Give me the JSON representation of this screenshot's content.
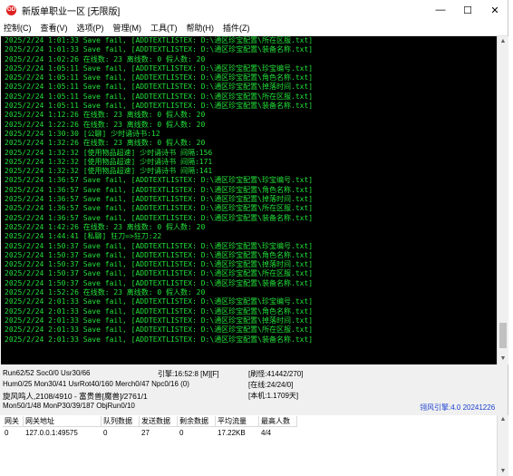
{
  "window": {
    "title": "新版单职业一区 [无限版]",
    "app_icon_glyph": "OD"
  },
  "menu": [
    "控制(C)",
    "查看(V)",
    "选项(P)",
    "管理(M)",
    "工具(T)",
    "帮助(H)",
    "插件(Z)"
  ],
  "log_lines": [
    "2025/2/24 1:01:33 Save fail, [ADDTEXTLISTEX: D:\\通区珍宝配置\\所在区服.txt]",
    "2025/2/24 1:01:33 Save fail, [ADDTEXTLISTEX: D:\\通区珍宝配置\\装备名称.txt]",
    "2025/2/24 1:02:26 在线数: 23 离线数: 0 假人数: 20",
    "2025/2/24 1:05:11 Save fail, [ADDTEXTLISTEX: D:\\通区珍宝配置\\珍宝编号.txt]",
    "2025/2/24 1:05:11 Save fail, [ADDTEXTLISTEX: D:\\通区珍宝配置\\角色名称.txt]",
    "2025/2/24 1:05:11 Save fail, [ADDTEXTLISTEX: D:\\通区珍宝配置\\掉落时间.txt]",
    "2025/2/24 1:05:11 Save fail, [ADDTEXTLISTEX: D:\\通区珍宝配置\\所在区服.txt]",
    "2025/2/24 1:05:11 Save fail, [ADDTEXTLISTEX: D:\\通区珍宝配置\\装备名称.txt]",
    "2025/2/24 1:12:26 在线数: 23 离线数: 0 假人数: 20",
    "2025/2/24 1:22:26 在线数: 23 离线数: 0 假人数: 20",
    "2025/2/24 1:30:30 [公聊] 少时诵诗书:12",
    "2025/2/24 1:32:26 在线数: 23 离线数: 0 假人数: 20",
    "2025/2/24 1:32:32 [使用物品超速] 少时诵诗书 间隔:156",
    "2025/2/24 1:32:32 [使用物品超速] 少时诵诗书 间隔:171",
    "2025/2/24 1:32:32 [使用物品超速] 少时诵诗书 间隔:141",
    "2025/2/24 1:36:57 Save fail, [ADDTEXTLISTEX: D:\\通区珍宝配置\\珍宝编号.txt]",
    "2025/2/24 1:36:57 Save fail, [ADDTEXTLISTEX: D:\\通区珍宝配置\\角色名称.txt]",
    "2025/2/24 1:36:57 Save fail, [ADDTEXTLISTEX: D:\\通区珍宝配置\\掉落时间.txt]",
    "2025/2/24 1:36:57 Save fail, [ADDTEXTLISTEX: D:\\通区珍宝配置\\所在区服.txt]",
    "2025/2/24 1:36:57 Save fail, [ADDTEXTLISTEX: D:\\通区珍宝配置\\装备名称.txt]",
    "2025/2/24 1:42:26 在线数: 23 离线数: 0 假人数: 20",
    "2025/2/24 1:44:41 [私聊] 狂刀=>狂刀:22",
    "2025/2/24 1:50:37 Save fail, [ADDTEXTLISTEX: D:\\通区珍宝配置\\珍宝编号.txt]",
    "2025/2/24 1:50:37 Save fail, [ADDTEXTLISTEX: D:\\通区珍宝配置\\角色名称.txt]",
    "2025/2/24 1:50:37 Save fail, [ADDTEXTLISTEX: D:\\通区珍宝配置\\掉落时间.txt]",
    "2025/2/24 1:50:37 Save fail, [ADDTEXTLISTEX: D:\\通区珍宝配置\\所在区服.txt]",
    "2025/2/24 1:50:37 Save fail, [ADDTEXTLISTEX: D:\\通区珍宝配置\\装备名称.txt]",
    "2025/2/24 1:52:26 在线数: 23 离线数: 0 假人数: 20",
    "2025/2/24 2:01:33 Save fail, [ADDTEXTLISTEX: D:\\通区珍宝配置\\珍宝编号.txt]",
    "2025/2/24 2:01:33 Save fail, [ADDTEXTLISTEX: D:\\通区珍宝配置\\角色名称.txt]",
    "2025/2/24 2:01:33 Save fail, [ADDTEXTLISTEX: D:\\通区珍宝配置\\掉落时间.txt]",
    "2025/2/24 2:01:33 Save fail, [ADDTEXTLISTEX: D:\\通区珍宝配置\\所在区服.txt]",
    "2025/2/24 2:01:33 Save fail, [ADDTEXTLISTEX: D:\\通区珍宝配置\\装备名称.txt]"
  ],
  "status": {
    "line1_a": "Run62/52 Soc0/0 Usr30/66",
    "line1_b": "引擎:16:52:8 [M][F]",
    "line1_c": "[刷怪:41442/270]",
    "line2_a": "Hum0/25 Mon30/41 UsrRot40/160 Merch0/47 Npc0/16 (0)",
    "line2_c": "[在线:24/24/0]",
    "line3_a": "旋风鸣人,2108/4910 - 富贵兽[魔兽]/2761/1",
    "line3_c": "[本机:1.1709天]",
    "line4_a": "Mon50/1/48 MonP30/39/187 ObjRun0/10",
    "engine_version": "翎风引擎:4.0 20241226"
  },
  "table": {
    "headers": [
      "网关",
      "网关地址",
      "队列数据",
      "发送数据",
      "剩余数据",
      "平均流量",
      "最高人数"
    ],
    "rows": [
      [
        "0",
        "127.0.0.1:49575",
        "0",
        "27",
        "0",
        "17.22KB",
        "4/4"
      ]
    ]
  },
  "colors": {
    "log_text": "#22e03a",
    "log_bg": "#000000",
    "engine_version": "#1a3fd0"
  }
}
